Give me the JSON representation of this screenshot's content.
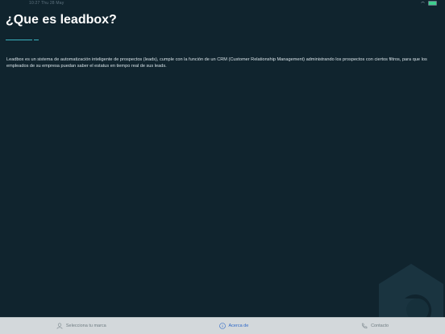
{
  "status_bar": {
    "time": "10:27 Thu 28 May"
  },
  "page": {
    "title": "¿Que es leadbox?",
    "description": "Leadbox es un sistema de automatización inteligente de prospectos (leads), cumple con la función de un CRM (Customer Relationship Management) administrando los prospectos con ciertos filtros, para que los empleados de su empresa puedan saber el estatus en tiempo real de sus leads."
  },
  "tabbar": {
    "tabs": [
      {
        "label": "Selecciona tu marca",
        "icon": "person-icon",
        "active": false
      },
      {
        "label": "Acerca de",
        "icon": "info-icon",
        "active": true
      },
      {
        "label": "Contacto",
        "icon": "phone-icon",
        "active": false
      }
    ]
  },
  "colors": {
    "background": "#10242e",
    "accent": "#3bb3c0",
    "active_tab": "#2a66c7"
  }
}
